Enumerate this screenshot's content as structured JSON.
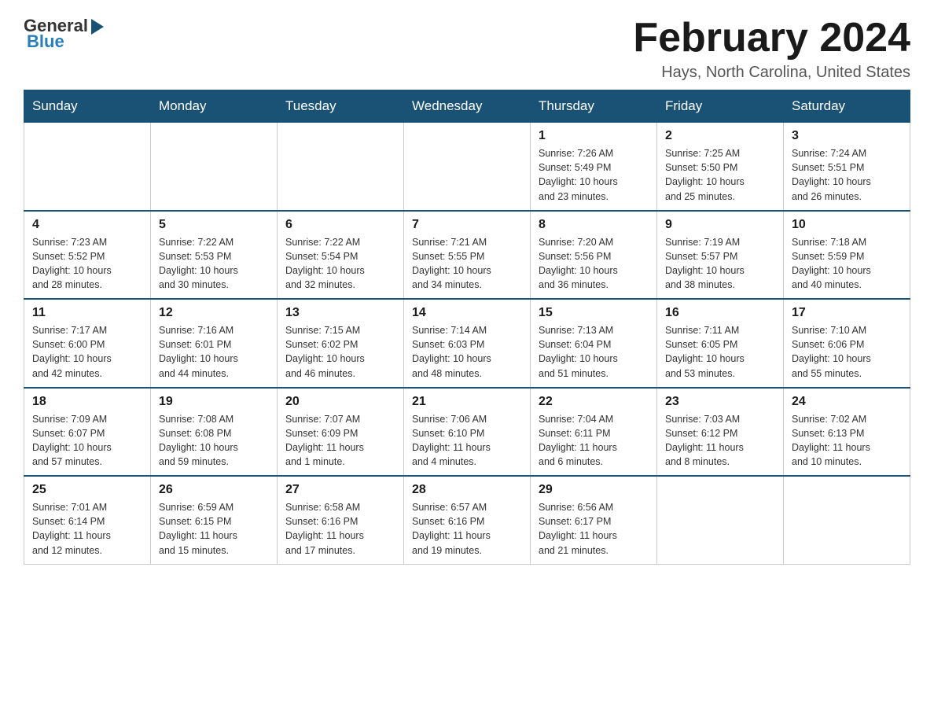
{
  "header": {
    "logo_general": "General",
    "logo_blue": "Blue",
    "month_title": "February 2024",
    "location": "Hays, North Carolina, United States"
  },
  "weekdays": [
    "Sunday",
    "Monday",
    "Tuesday",
    "Wednesday",
    "Thursday",
    "Friday",
    "Saturday"
  ],
  "weeks": [
    [
      {
        "day": "",
        "info": ""
      },
      {
        "day": "",
        "info": ""
      },
      {
        "day": "",
        "info": ""
      },
      {
        "day": "",
        "info": ""
      },
      {
        "day": "1",
        "info": "Sunrise: 7:26 AM\nSunset: 5:49 PM\nDaylight: 10 hours\nand 23 minutes."
      },
      {
        "day": "2",
        "info": "Sunrise: 7:25 AM\nSunset: 5:50 PM\nDaylight: 10 hours\nand 25 minutes."
      },
      {
        "day": "3",
        "info": "Sunrise: 7:24 AM\nSunset: 5:51 PM\nDaylight: 10 hours\nand 26 minutes."
      }
    ],
    [
      {
        "day": "4",
        "info": "Sunrise: 7:23 AM\nSunset: 5:52 PM\nDaylight: 10 hours\nand 28 minutes."
      },
      {
        "day": "5",
        "info": "Sunrise: 7:22 AM\nSunset: 5:53 PM\nDaylight: 10 hours\nand 30 minutes."
      },
      {
        "day": "6",
        "info": "Sunrise: 7:22 AM\nSunset: 5:54 PM\nDaylight: 10 hours\nand 32 minutes."
      },
      {
        "day": "7",
        "info": "Sunrise: 7:21 AM\nSunset: 5:55 PM\nDaylight: 10 hours\nand 34 minutes."
      },
      {
        "day": "8",
        "info": "Sunrise: 7:20 AM\nSunset: 5:56 PM\nDaylight: 10 hours\nand 36 minutes."
      },
      {
        "day": "9",
        "info": "Sunrise: 7:19 AM\nSunset: 5:57 PM\nDaylight: 10 hours\nand 38 minutes."
      },
      {
        "day": "10",
        "info": "Sunrise: 7:18 AM\nSunset: 5:59 PM\nDaylight: 10 hours\nand 40 minutes."
      }
    ],
    [
      {
        "day": "11",
        "info": "Sunrise: 7:17 AM\nSunset: 6:00 PM\nDaylight: 10 hours\nand 42 minutes."
      },
      {
        "day": "12",
        "info": "Sunrise: 7:16 AM\nSunset: 6:01 PM\nDaylight: 10 hours\nand 44 minutes."
      },
      {
        "day": "13",
        "info": "Sunrise: 7:15 AM\nSunset: 6:02 PM\nDaylight: 10 hours\nand 46 minutes."
      },
      {
        "day": "14",
        "info": "Sunrise: 7:14 AM\nSunset: 6:03 PM\nDaylight: 10 hours\nand 48 minutes."
      },
      {
        "day": "15",
        "info": "Sunrise: 7:13 AM\nSunset: 6:04 PM\nDaylight: 10 hours\nand 51 minutes."
      },
      {
        "day": "16",
        "info": "Sunrise: 7:11 AM\nSunset: 6:05 PM\nDaylight: 10 hours\nand 53 minutes."
      },
      {
        "day": "17",
        "info": "Sunrise: 7:10 AM\nSunset: 6:06 PM\nDaylight: 10 hours\nand 55 minutes."
      }
    ],
    [
      {
        "day": "18",
        "info": "Sunrise: 7:09 AM\nSunset: 6:07 PM\nDaylight: 10 hours\nand 57 minutes."
      },
      {
        "day": "19",
        "info": "Sunrise: 7:08 AM\nSunset: 6:08 PM\nDaylight: 10 hours\nand 59 minutes."
      },
      {
        "day": "20",
        "info": "Sunrise: 7:07 AM\nSunset: 6:09 PM\nDaylight: 11 hours\nand 1 minute."
      },
      {
        "day": "21",
        "info": "Sunrise: 7:06 AM\nSunset: 6:10 PM\nDaylight: 11 hours\nand 4 minutes."
      },
      {
        "day": "22",
        "info": "Sunrise: 7:04 AM\nSunset: 6:11 PM\nDaylight: 11 hours\nand 6 minutes."
      },
      {
        "day": "23",
        "info": "Sunrise: 7:03 AM\nSunset: 6:12 PM\nDaylight: 11 hours\nand 8 minutes."
      },
      {
        "day": "24",
        "info": "Sunrise: 7:02 AM\nSunset: 6:13 PM\nDaylight: 11 hours\nand 10 minutes."
      }
    ],
    [
      {
        "day": "25",
        "info": "Sunrise: 7:01 AM\nSunset: 6:14 PM\nDaylight: 11 hours\nand 12 minutes."
      },
      {
        "day": "26",
        "info": "Sunrise: 6:59 AM\nSunset: 6:15 PM\nDaylight: 11 hours\nand 15 minutes."
      },
      {
        "day": "27",
        "info": "Sunrise: 6:58 AM\nSunset: 6:16 PM\nDaylight: 11 hours\nand 17 minutes."
      },
      {
        "day": "28",
        "info": "Sunrise: 6:57 AM\nSunset: 6:16 PM\nDaylight: 11 hours\nand 19 minutes."
      },
      {
        "day": "29",
        "info": "Sunrise: 6:56 AM\nSunset: 6:17 PM\nDaylight: 11 hours\nand 21 minutes."
      },
      {
        "day": "",
        "info": ""
      },
      {
        "day": "",
        "info": ""
      }
    ]
  ]
}
